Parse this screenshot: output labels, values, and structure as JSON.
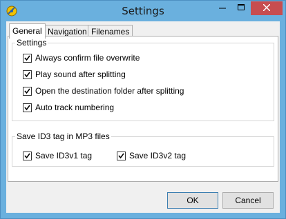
{
  "window": {
    "title": "Settings"
  },
  "tabs": [
    {
      "label": "General",
      "active": true
    },
    {
      "label": "Navigation",
      "active": false
    },
    {
      "label": "Filenames",
      "active": false
    }
  ],
  "settings_group": {
    "title": "Settings",
    "options": [
      {
        "label": "Always confirm file overwrite",
        "checked": true
      },
      {
        "label": "Play sound after splitting",
        "checked": true
      },
      {
        "label": "Open the destination folder after splitting",
        "checked": true
      },
      {
        "label": "Auto track numbering",
        "checked": true
      }
    ]
  },
  "id3_group": {
    "title": "Save ID3 tag in MP3 files",
    "options": [
      {
        "label": "Save ID3v1 tag",
        "checked": true
      },
      {
        "label": "Save ID3v2 tag",
        "checked": true
      }
    ]
  },
  "buttons": {
    "ok": "OK",
    "cancel": "Cancel"
  },
  "icons": {
    "app": "app-icon",
    "minimize": "minimize-icon",
    "maximize": "maximize-icon",
    "close": "close-icon"
  }
}
